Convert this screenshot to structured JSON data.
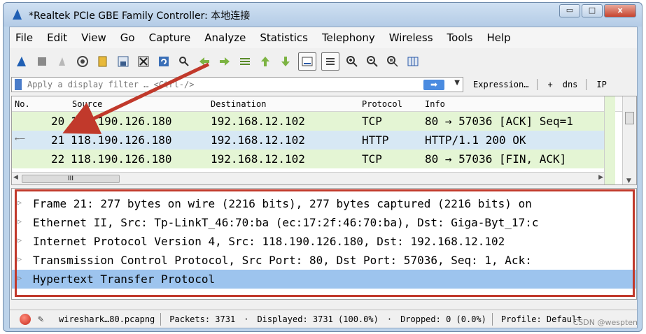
{
  "window": {
    "title": "*Realtek PCIe GBE Family Controller: 本地连接",
    "minimize": "▭",
    "maximize": "□",
    "close": "x"
  },
  "menu": [
    "File",
    "Edit",
    "View",
    "Go",
    "Capture",
    "Analyze",
    "Statistics",
    "Telephony",
    "Wireless",
    "Tools",
    "Help"
  ],
  "toolbar": {
    "icons": [
      "shark-fin-icon",
      "stop-icon",
      "restart-icon",
      "options-icon",
      "open-icon",
      "save-icon",
      "close-file-icon",
      "reload-icon",
      "find-icon",
      "back-icon",
      "forward-icon",
      "goto-icon",
      "first-icon",
      "last-icon",
      "autoscroll-icon",
      "colorize-icon",
      "zoom-in-icon",
      "zoom-out-icon",
      "zoom-normal-icon",
      "resize-columns-icon"
    ]
  },
  "filter": {
    "placeholder": "Apply a display filter … <Ctrl-/>",
    "expression_label": "Expression…",
    "plus": "+",
    "dns_label": "dns",
    "ip_label": "IP"
  },
  "packet_list": {
    "columns": {
      "no": "No.",
      "source": "Source",
      "destination": "Destination",
      "protocol": "Protocol",
      "info": "Info"
    },
    "rows": [
      {
        "no": "20",
        "source": "118.190.126.180",
        "destination": "192.168.12.102",
        "protocol": "TCP",
        "info": "80 → 57036 [ACK] Seq=1",
        "bg": "#e4f5d4"
      },
      {
        "no": "21",
        "source": "118.190.126.180",
        "destination": "192.168.12.102",
        "protocol": "HTTP",
        "info": "HTTP/1.1 200 OK",
        "bg": "#d7e8f4"
      },
      {
        "no": "22",
        "source": "118.190.126.180",
        "destination": "192.168.12.102",
        "protocol": "TCP",
        "info": "80 → 57036 [FIN, ACK]",
        "bg": "#e4f5d4"
      }
    ],
    "hscroll_label": "III"
  },
  "details": {
    "rows": [
      {
        "text": "Frame 21: 277 bytes on wire (2216 bits), 277 bytes captured (2216 bits) on",
        "selected": false
      },
      {
        "text": "Ethernet II, Src: Tp-LinkT_46:70:ba (ec:17:2f:46:70:ba), Dst: Giga-Byt_17:c",
        "selected": false
      },
      {
        "text": "Internet Protocol Version 4, Src: 118.190.126.180, Dst: 192.168.12.102",
        "selected": false
      },
      {
        "text": "Transmission Control Protocol, Src Port: 80, Dst Port: 57036, Seq: 1, Ack:",
        "selected": false
      },
      {
        "text": "Hypertext Transfer Protocol",
        "selected": true
      }
    ]
  },
  "status": {
    "file": "wireshark…80.pcapng",
    "packets": "Packets: 3731",
    "displayed": "Displayed: 3731 (100.0%)",
    "dropped": "Dropped: 0 (0.0%)",
    "profile": "Profile: Default"
  },
  "watermark": "CSDN @wespten",
  "colors": {
    "annotation_red": "#c1392b",
    "selected_blue": "#9dc4ee"
  }
}
